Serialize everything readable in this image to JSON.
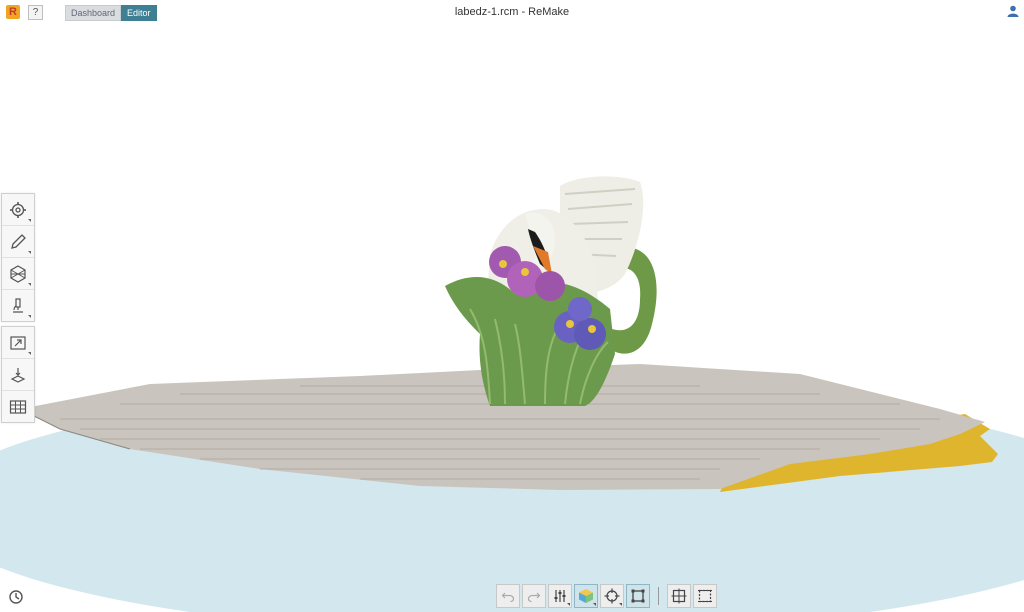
{
  "titlebar": {
    "app_logo_letter": "R",
    "help_label": "?",
    "tabs": [
      {
        "label": "Dashboard",
        "active": false
      },
      {
        "label": "Editor",
        "active": true
      }
    ],
    "window_title": "labedz-1.rcm - ReMake"
  },
  "colors": {
    "accent": "#3f7f93",
    "ground_plane": "#cfe3ea",
    "paper": "#c9c4bd",
    "yellow_paper": "#e0b52e"
  },
  "side_toolbar": {
    "group1": [
      {
        "icon": "settings-icon"
      },
      {
        "icon": "pencil-icon"
      },
      {
        "icon": "mesh-icon"
      },
      {
        "icon": "microscope-icon"
      }
    ],
    "group2": [
      {
        "icon": "export-icon"
      },
      {
        "icon": "print-3d-icon"
      },
      {
        "icon": "table-icon"
      }
    ]
  },
  "bottom_toolbar": [
    {
      "icon": "undo-icon"
    },
    {
      "icon": "redo-icon"
    },
    {
      "icon": "sliders-icon"
    },
    {
      "icon": "cube-icon",
      "active": true
    },
    {
      "icon": "crosshair-icon"
    },
    {
      "icon": "bounding-box-icon",
      "active": true
    },
    {
      "icon": "fit-view-icon"
    },
    {
      "icon": "measure-icon"
    }
  ]
}
